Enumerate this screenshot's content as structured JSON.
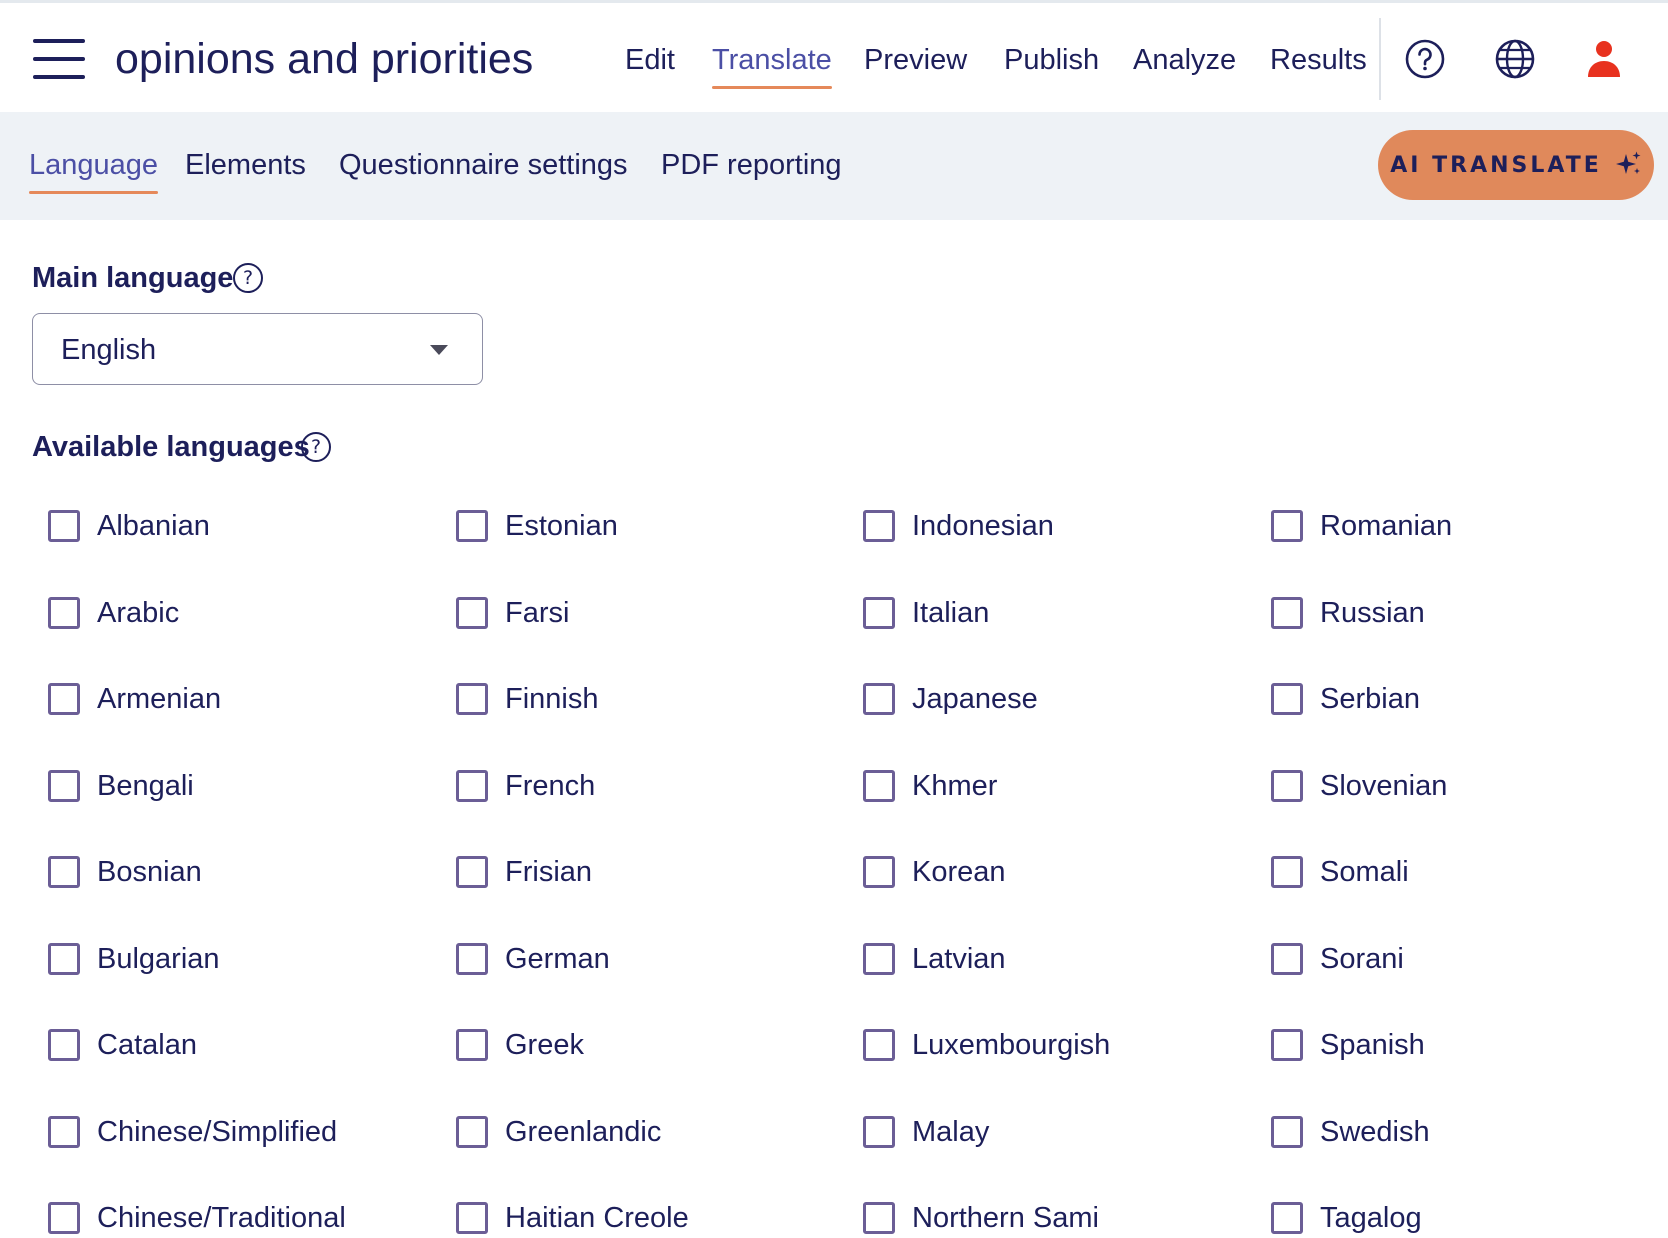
{
  "header": {
    "title": "opinions and priorities",
    "nav": [
      {
        "label": "Edit",
        "active": false
      },
      {
        "label": "Translate",
        "active": true
      },
      {
        "label": "Preview",
        "active": false
      },
      {
        "label": "Publish",
        "active": false
      },
      {
        "label": "Analyze",
        "active": false
      },
      {
        "label": "Results",
        "active": false
      }
    ],
    "icons": [
      "help-icon",
      "globe-icon",
      "user-icon"
    ]
  },
  "subnav": {
    "tabs": [
      {
        "label": "Language",
        "active": true
      },
      {
        "label": "Elements",
        "active": false
      },
      {
        "label": "Questionnaire settings",
        "active": false
      },
      {
        "label": "PDF reporting",
        "active": false
      }
    ],
    "ai_button": "AI TRANSLATE"
  },
  "main": {
    "main_language_title": "Main language",
    "main_language_value": "English",
    "available_languages_title": "Available languages",
    "help_glyph": "?",
    "languages": [
      [
        "Albanian",
        "Arabic",
        "Armenian",
        "Bengali",
        "Bosnian",
        "Bulgarian",
        "Catalan",
        "Chinese/Simplified",
        "Chinese/Traditional"
      ],
      [
        "Estonian",
        "Farsi",
        "Finnish",
        "French",
        "Frisian",
        "German",
        "Greek",
        "Greenlandic",
        "Haitian Creole"
      ],
      [
        "Indonesian",
        "Italian",
        "Japanese",
        "Khmer",
        "Korean",
        "Latvian",
        "Luxembourgish",
        "Malay",
        "Northern Sami"
      ],
      [
        "Romanian",
        "Russian",
        "Serbian",
        "Slovenian",
        "Somali",
        "Sorani",
        "Spanish",
        "Swedish",
        "Tagalog"
      ]
    ]
  },
  "colors": {
    "text": "#1d1f5a",
    "active": "#4b4fa5",
    "accent": "#e0895b",
    "user_icon": "#e8321f",
    "checkbox": "#6b5e96"
  }
}
